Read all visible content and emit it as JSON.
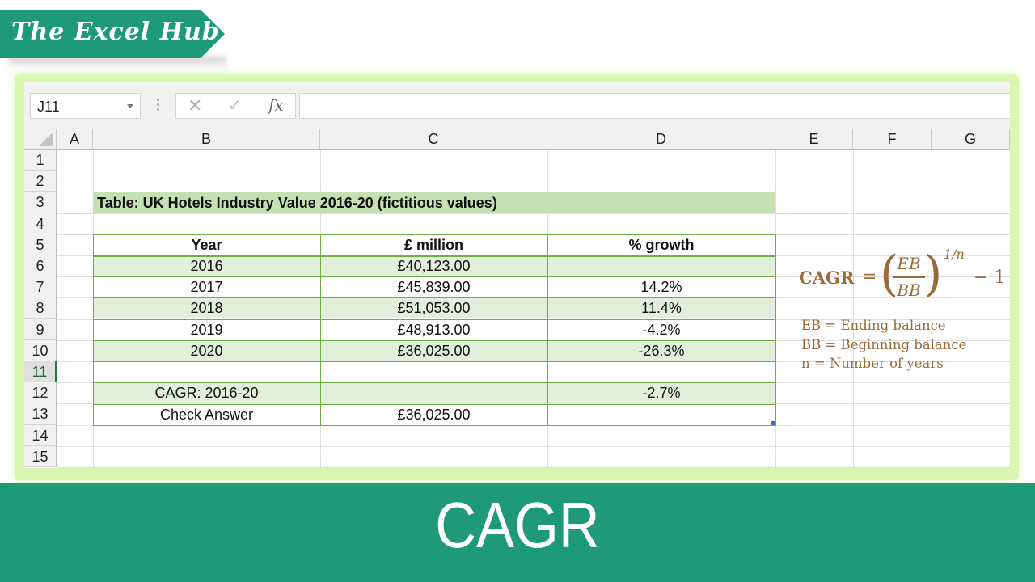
{
  "branding": {
    "logo_text": "The Excel Hub",
    "brand_color": "#1f9a78",
    "frame_color": "#d9f7b0"
  },
  "formula_bar": {
    "name_box": "J11",
    "cancel_icon": "✕",
    "enter_icon": "✓",
    "fx_label": "fx",
    "formula_value": ""
  },
  "columns": [
    "A",
    "B",
    "C",
    "D",
    "E",
    "F",
    "G"
  ],
  "rows": [
    "1",
    "2",
    "3",
    "4",
    "5",
    "6",
    "7",
    "8",
    "9",
    "10",
    "11",
    "12",
    "13",
    "14",
    "15"
  ],
  "selected_row": "11",
  "sheet": {
    "title": "Table: UK Hotels Industry Value 2016-20 (fictitious values)",
    "headers": [
      "Year",
      "£ million",
      "% growth"
    ],
    "data": [
      {
        "year": "2016",
        "value": "£40,123.00",
        "growth": ""
      },
      {
        "year": "2017",
        "value": "£45,839.00",
        "growth": "14.2%"
      },
      {
        "year": "2018",
        "value": "£51,053.00",
        "growth": "11.4%"
      },
      {
        "year": "2019",
        "value": "£48,913.00",
        "growth": "-4.2%"
      },
      {
        "year": "2020",
        "value": "£36,025.00",
        "growth": "-26.3%"
      }
    ],
    "cagr_label": "CAGR: 2016-20",
    "cagr_value": "-2.7%",
    "check_label": "Check Answer",
    "check_value": "£36,025.00"
  },
  "formula_panel": {
    "lhs": "CAGR",
    "eq": "=",
    "numerator": "EB",
    "denominator": "BB",
    "exponent": "1/n",
    "minus_one": "− 1",
    "legend": [
      "EB = Ending balance",
      "BB = Beginning balance",
      "n = Number of years"
    ]
  },
  "bottom_title": "CAGR"
}
